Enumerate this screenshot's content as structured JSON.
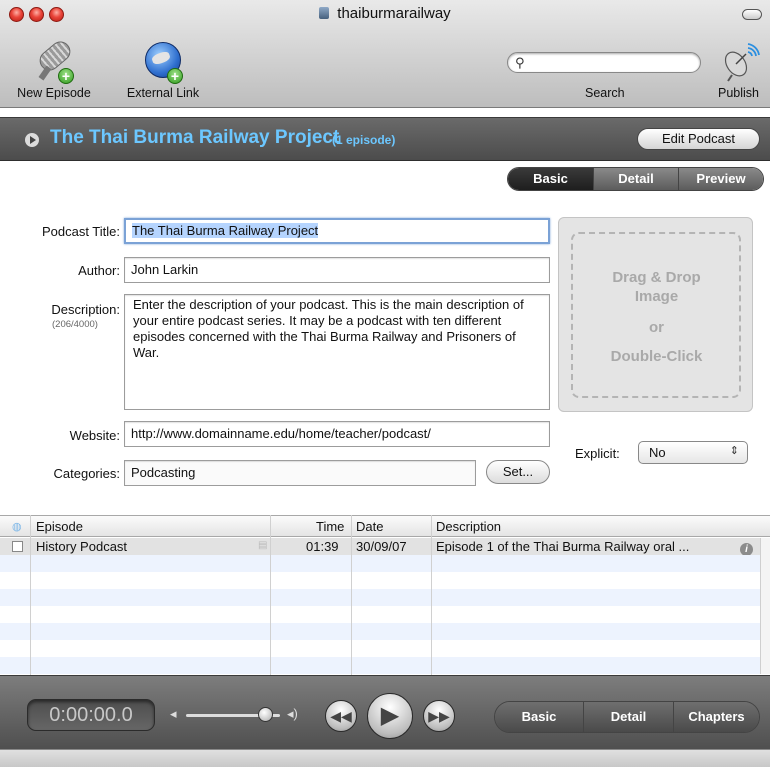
{
  "window": {
    "title": "thaiburmarailway"
  },
  "toolbar": {
    "new_episode_label": "New Episode",
    "external_link_label": "External Link",
    "search_label": "Search",
    "search_placeholder": "",
    "publish_label": "Publish"
  },
  "podcast": {
    "title": "The Thai Burma Railway Project",
    "episode_count": "(1 episode)",
    "edit_label": "Edit Podcast"
  },
  "top_tabs": [
    "Basic",
    "Detail",
    "Preview"
  ],
  "form": {
    "title_label": "Podcast Title:",
    "title_value": "The Thai Burma Railway Project",
    "author_label": "Author:",
    "author_value": "John Larkin",
    "description_label": "Description:",
    "description_count": "(206/4000)",
    "description_value": "Enter the description of your podcast. This is the main description of your entire podcast series. It may be a podcast with ten different episodes concerned with the Thai Burma Railway and Prisoners of War.",
    "website_label": "Website:",
    "website_value": "http://www.domainname.edu/home/teacher/podcast/",
    "categories_label": "Categories:",
    "categories_value": "Podcasting",
    "set_label": "Set...",
    "explicit_label": "Explicit:",
    "explicit_value": "No"
  },
  "dropzone": {
    "line1": "Drag & Drop",
    "line2": "Image",
    "line3": "or",
    "line4": "Double-Click"
  },
  "table": {
    "headers": {
      "episode": "Episode",
      "time": "Time",
      "date": "Date",
      "description": "Description"
    },
    "rows": [
      {
        "episode": "History Podcast",
        "time": "01:39",
        "date": "30/09/07",
        "description": "Episode 1 of the Thai Burma Railway oral ..."
      }
    ]
  },
  "player": {
    "time": "0:00:00.0",
    "volume_level": 0.85,
    "tabs": [
      "Basic",
      "Detail",
      "Chapters"
    ]
  },
  "colors": {
    "accent": "#6cc7ff",
    "band": "#555555",
    "selection": "#b5d4fe"
  }
}
